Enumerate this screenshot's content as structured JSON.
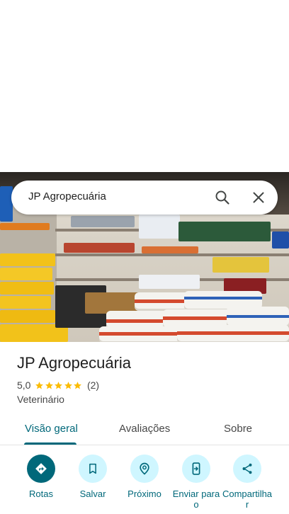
{
  "search": {
    "query": "JP Agropecuária"
  },
  "place": {
    "name": "JP Agropecuária",
    "rating": "5,0",
    "review_count": "(2)",
    "stars_filled": 5,
    "category": "Veterinário"
  },
  "tabs": [
    {
      "label": "Visão geral",
      "active": true
    },
    {
      "label": "Avaliações",
      "active": false
    },
    {
      "label": "Sobre",
      "active": false
    }
  ],
  "actions": [
    {
      "label": "Rotas",
      "icon": "directions-icon"
    },
    {
      "label": "Salvar",
      "icon": "bookmark-icon"
    },
    {
      "label": "Próximo",
      "icon": "nearby-icon"
    },
    {
      "label": "Enviar para o",
      "icon": "send-to-phone-icon"
    },
    {
      "label": "Compartilhar",
      "icon": "share-icon"
    }
  ],
  "colors": {
    "accent": "#00687a",
    "action_bg": "#cff6ff",
    "star": "#fbbc04",
    "text_primary": "#1f1f1f",
    "text_secondary": "#474747"
  }
}
